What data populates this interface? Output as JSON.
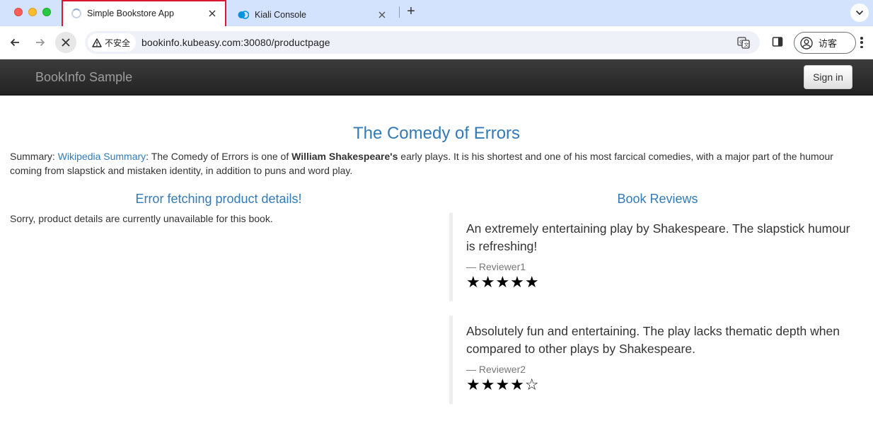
{
  "browser": {
    "tabs": [
      {
        "title": "Simple Bookstore App",
        "active": true,
        "loading": true
      },
      {
        "title": "Kiali Console",
        "active": false,
        "icon": "kiali-icon"
      }
    ],
    "security_label": "不安全",
    "url": "bookinfo.kubeasy.com:30080/productpage",
    "profile_label": "访客",
    "highlight_color": "#d9182e"
  },
  "navbar": {
    "brand": "BookInfo Sample",
    "signin_label": "Sign in"
  },
  "product": {
    "title": "The Comedy of Errors",
    "summary_prefix": "Summary: ",
    "summary_link": "Wikipedia Summary",
    "summary_mid": ": The Comedy of Errors is one of ",
    "summary_bold": "William Shakespeare's",
    "summary_rest": " early plays. It is his shortest and one of his most farcical comedies, with a major part of the humour coming from slapstick and mistaken identity, in addition to puns and word play."
  },
  "details": {
    "heading": "Error fetching product details!",
    "message": "Sorry, product details are currently unavailable for this book."
  },
  "reviews": {
    "heading": "Book Reviews",
    "items": [
      {
        "text": "An extremely entertaining play by Shakespeare. The slapstick humour is refreshing!",
        "reviewer": "— Reviewer1",
        "rating": 5,
        "stars": "★★★★★"
      },
      {
        "text": "Absolutely fun and entertaining. The play lacks thematic depth when compared to other plays by Shakespeare.",
        "reviewer": "— Reviewer2",
        "rating": 4,
        "stars": "★★★★☆"
      }
    ]
  }
}
